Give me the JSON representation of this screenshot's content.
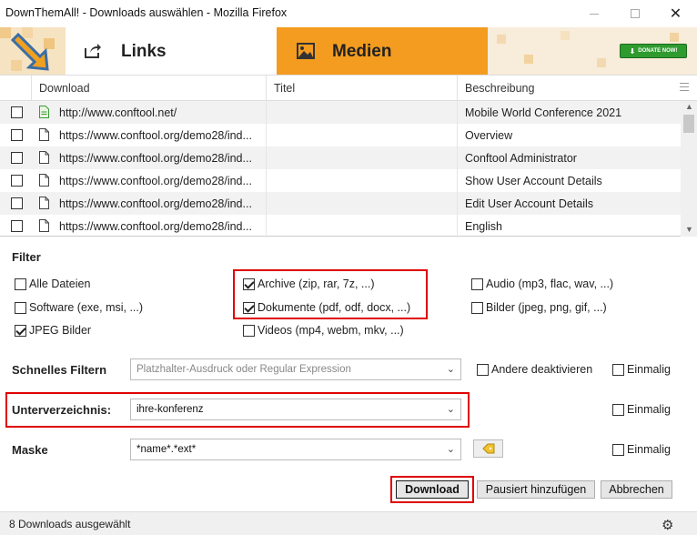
{
  "window": {
    "title": "DownThemAll! - Downloads auswählen - Mozilla Firefox"
  },
  "tabs": [
    {
      "label": "Links",
      "icon": "share-icon",
      "active": true
    },
    {
      "label": "Medien",
      "icon": "image-icon",
      "active": false
    }
  ],
  "donate_label": "DONATE NOW!",
  "table": {
    "columns": [
      "Download",
      "Titel",
      "Beschreibung"
    ],
    "rows": [
      {
        "url": "http://www.conftool.net/",
        "title": "",
        "description": "Mobile World Conference 2021",
        "checked": false,
        "icon": "html-file-icon"
      },
      {
        "url": "https://www.conftool.org/demo28/ind...",
        "title": "",
        "description": "Overview",
        "checked": false,
        "icon": "file-icon"
      },
      {
        "url": "https://www.conftool.org/demo28/ind...",
        "title": "",
        "description": "Conftool Administrator",
        "checked": false,
        "icon": "file-icon"
      },
      {
        "url": "https://www.conftool.org/demo28/ind...",
        "title": "",
        "description": "Show User Account Details",
        "checked": false,
        "icon": "file-icon"
      },
      {
        "url": "https://www.conftool.org/demo28/ind...",
        "title": "",
        "description": "Edit User Account Details",
        "checked": false,
        "icon": "file-icon"
      },
      {
        "url": "https://www.conftool.org/demo28/ind...",
        "title": "",
        "description": "English",
        "checked": false,
        "icon": "file-icon"
      }
    ]
  },
  "filter": {
    "title": "Filter",
    "options": [
      {
        "label": "Alle Dateien",
        "checked": false
      },
      {
        "label": "Archive (zip, rar, 7z, ...)",
        "checked": true
      },
      {
        "label": "Audio (mp3, flac, wav, ...)",
        "checked": false
      },
      {
        "label": "Software (exe, msi, ...)",
        "checked": false
      },
      {
        "label": "Dokumente (pdf, odf, docx, ...)",
        "checked": true
      },
      {
        "label": "Bilder (jpeg, png, gif, ...)",
        "checked": false
      },
      {
        "label": "JPEG Bilder",
        "checked": true
      },
      {
        "label": "Videos (mp4, webm, mkv, ...)",
        "checked": false
      }
    ]
  },
  "quickfilter": {
    "label": "Schnelles Filtern",
    "placeholder": "Platzhalter-Ausdruck oder Regular Expression",
    "disable_others_label": "Andere deaktivieren",
    "once_label": "Einmalig"
  },
  "subdir": {
    "label": "Unterverzeichnis:",
    "value": "ihre-konferenz",
    "once_label": "Einmalig"
  },
  "mask": {
    "label": "Maske",
    "value": "*name*.*ext*",
    "once_label": "Einmalig"
  },
  "buttons": {
    "download": "Download",
    "pause_add": "Pausiert hinzufügen",
    "cancel": "Abbrechen"
  },
  "status": "8 Downloads ausgewählt",
  "colors": {
    "accent_orange": "#f39c1f",
    "highlight_red": "#e00000",
    "donate_green": "#2f9b2f"
  }
}
